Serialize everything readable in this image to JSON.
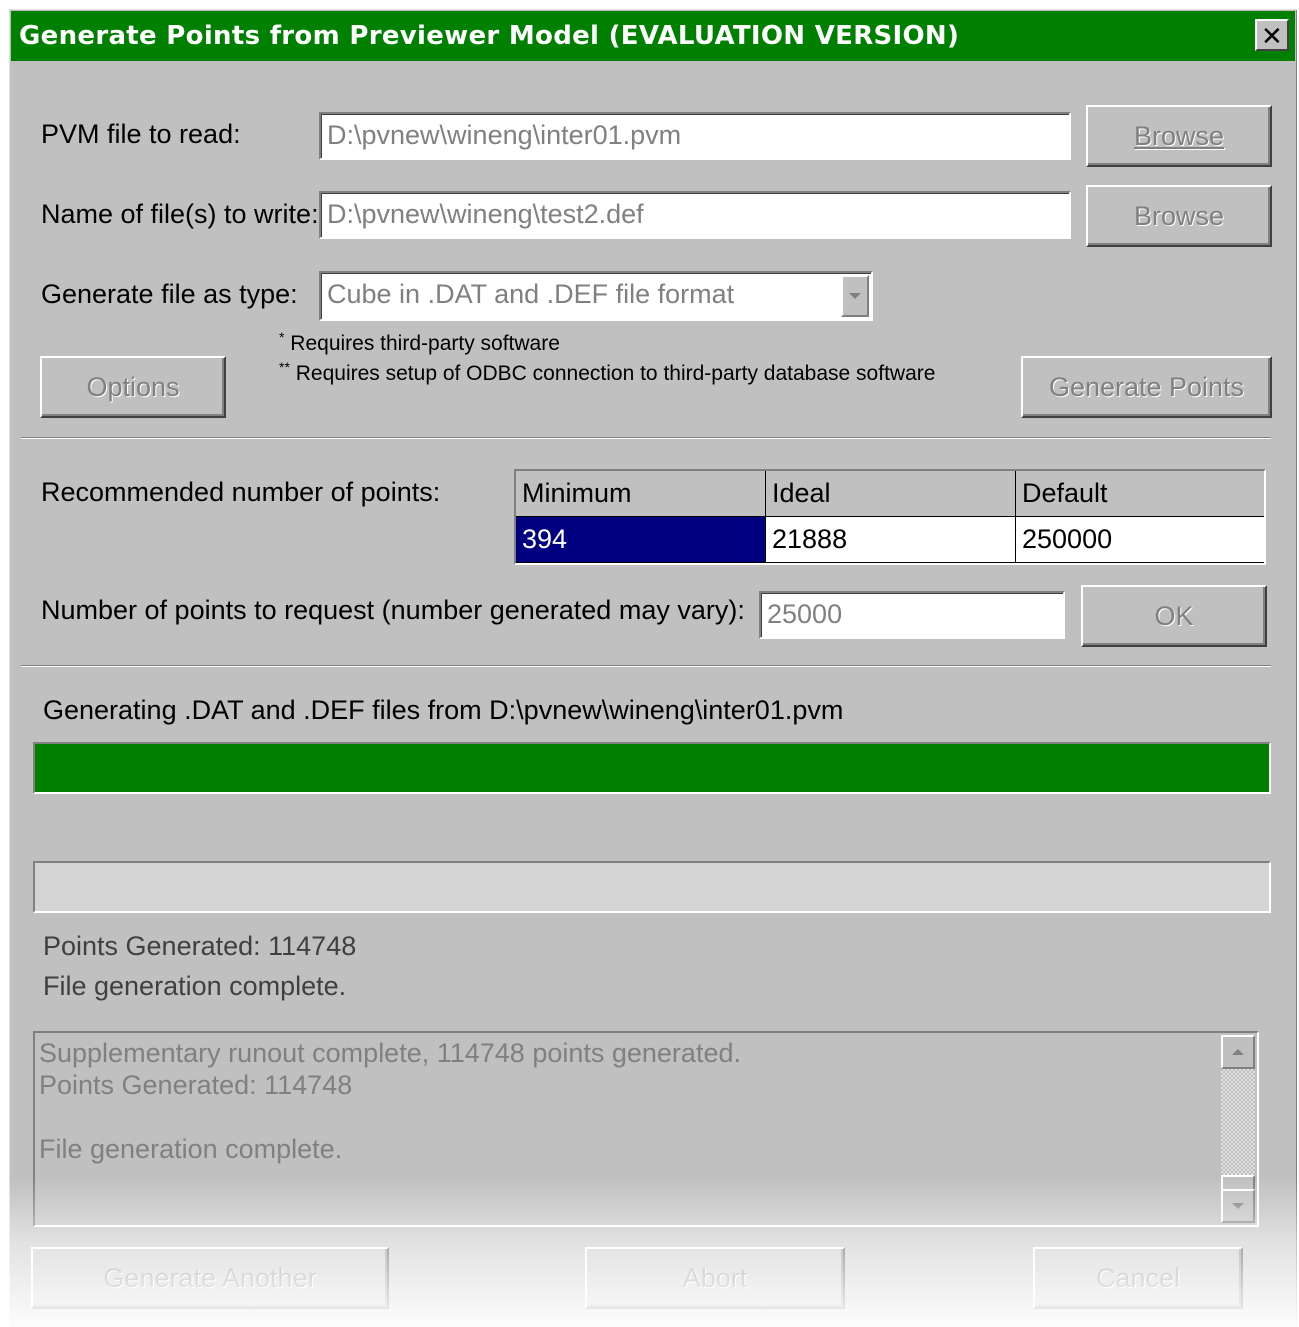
{
  "window": {
    "title": "Generate Points from Previewer Model (EVALUATION VERSION)",
    "close_glyph": "✕"
  },
  "pvm_file": {
    "label": "PVM file to read:",
    "value": "D:\\pvnew\\wineng\\inter01.pvm",
    "browse": "Browse"
  },
  "output_file": {
    "label": "Name of file(s) to write:",
    "value": "D:\\pvnew\\wineng\\test2.def",
    "browse": "Browse"
  },
  "file_type": {
    "label": "Generate file as type:",
    "value": "Cube in .DAT and .DEF file format"
  },
  "notes": {
    "note1_mark": "*",
    "note1": "Requires third-party software",
    "note2_mark": "**",
    "note2": "Requires setup of ODBC connection to third-party database software"
  },
  "buttons": {
    "options": "Options",
    "generate_points": "Generate Points",
    "ok": "OK",
    "generate_another": "Generate Another",
    "abort": "Abort",
    "cancel": "Cancel"
  },
  "recommended": {
    "label": "Recommended number of points:",
    "headers": [
      "Minimum",
      "Ideal",
      "Default"
    ],
    "values": [
      "394",
      "21888",
      "250000"
    ]
  },
  "request": {
    "label": "Number of points to request (number generated may vary):",
    "value": "25000"
  },
  "progress": {
    "caption": "Generating .DAT and .DEF files from D:\\pvnew\\wineng\\inter01.pvm",
    "primary_fraction": 1.0,
    "secondary_fraction": 0.0
  },
  "status": {
    "points_generated": "Points Generated: 114748",
    "message": "File generation complete."
  },
  "log": {
    "lines": [
      "Supplementary runout complete, 114748 points generated.",
      "Points Generated: 114748",
      "",
      "File generation complete."
    ]
  },
  "colors": {
    "title_bar": "#008000",
    "progress": "#008000",
    "selection": "#000080",
    "face": "#c0c0c0"
  }
}
